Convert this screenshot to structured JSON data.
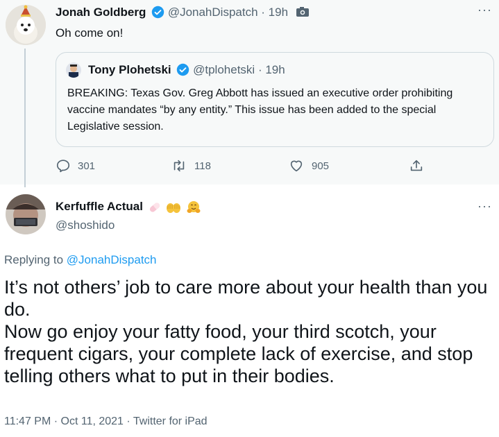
{
  "parent_tweet": {
    "author_name": "Jonah Goldberg",
    "handle": "@JonahDispatch",
    "separator": "·",
    "time": "19h",
    "text": "Oh come on!",
    "quoted": {
      "author_name": "Tony Plohetski",
      "handle": "@tplohetski",
      "separator": "·",
      "time": "19h",
      "text": "BREAKING: Texas Gov. Greg Abbott has issued an executive order prohibiting vaccine mandates “by any entity.” This issue has been added to the special Legislative session."
    },
    "actions": {
      "replies": "301",
      "retweets": "118",
      "likes": "905"
    }
  },
  "reply_tweet": {
    "author_name": "Kerfuffle Actual",
    "name_emojis": [
      "pill-emoji",
      "open-hands-emoji",
      "hugging-face-emoji"
    ],
    "handle": "@shoshido",
    "replying_prefix": "Replying to",
    "replying_handle": "@JonahDispatch",
    "text": "It’s not others’ job to care more about your health than you do.\nNow go enjoy your fatty food, your third scotch, your frequent cigars, your complete lack of exercise, and stop telling others what to put in their bodies.",
    "timestamp": "11:47 PM · Oct 11, 2021 · Twitter for iPad"
  },
  "colors": {
    "link": "#1d9bf0",
    "muted": "#536471",
    "verified": "#1d9bf0",
    "parent_bg": "#f7f9f9"
  }
}
